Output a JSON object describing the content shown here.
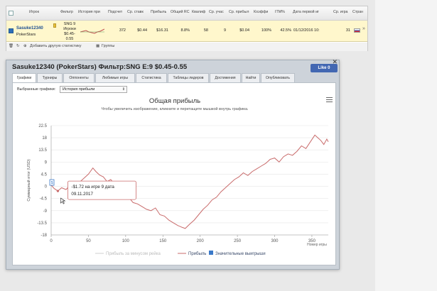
{
  "grid": {
    "headers": [
      "Игрок",
      "Фильтр",
      "История при",
      "Подсчет",
      "Ср. ставк",
      "Прибыль",
      "Общий RC",
      "Квалиф",
      "Ср. учас",
      "Ср. прибыл",
      "Коэффи",
      "ITM%",
      "Дата первой иг",
      "Ср. игра",
      "Стран"
    ],
    "row": {
      "player": "Sasuke12340",
      "site": "PokerStars",
      "filter": [
        "SNG 9",
        "Игроки",
        "$0.45-",
        "0.55"
      ],
      "count": "372",
      "avg_stake": "$0.44",
      "profit": "$16.31",
      "roi": "8.8%",
      "qualif": "58",
      "avg_part": "9",
      "avg_profit": "$0.04",
      "coef": "100%",
      "itm": "42.5%",
      "first_date": "01/12/2016 10:",
      "avg_game": "31"
    },
    "footer": {
      "add_label": "Добавить другую статистику",
      "groups_label": "Группы"
    }
  },
  "popup": {
    "title": "Sasuke12340 (PokerStars) Фильтр:SNG E:9 $0.45-0.55",
    "like_label": "Like 0",
    "tabs": [
      "Графики",
      "Турниры",
      "Оппоненты",
      "Любимые игры",
      "Статистика",
      "Таблицы лидеров",
      "Достижения",
      "Найти",
      "Опубликовать"
    ],
    "select_label": "Выбранные графики:",
    "select_value": "История прибыли"
  },
  "colors": {
    "profit_line": "#c96b6b",
    "big_win": "#3a79c9",
    "grid_line": "#e6e6e6"
  },
  "chart_data": {
    "type": "line",
    "title": "Общая прибыль",
    "subtitle": "Чтобы увеличить изображение, кликните и перетащите мышкой внутрь графика.",
    "ylabel": "Суммарный итог (USD)",
    "xlabel": "Номер игры",
    "xlim": [
      0,
      372
    ],
    "ylim": [
      -18,
      22.5
    ],
    "x_ticks": [
      0,
      50,
      100,
      150,
      200,
      250,
      300,
      350
    ],
    "y_ticks": [
      22.5,
      18,
      13.5,
      9,
      4.5,
      0,
      -4.5,
      -9,
      -13.5,
      -18
    ],
    "legend": [
      "Прибыль за минусом рейка",
      "Прибыль",
      "Значительные выигрыши"
    ],
    "series": [
      {
        "name": "Прибыль",
        "x": [
          0,
          4,
          9,
          14,
          20,
          26,
          32,
          38,
          44,
          50,
          56,
          60,
          65,
          70,
          75,
          80,
          86,
          92,
          98,
          104,
          110,
          116,
          122,
          128,
          134,
          140,
          146,
          152,
          158,
          164,
          170,
          176,
          180,
          186,
          192,
          198,
          204,
          210,
          216,
          222,
          228,
          234,
          240,
          246,
          252,
          258,
          264,
          270,
          276,
          282,
          288,
          294,
          300,
          306,
          312,
          318,
          324,
          330,
          336,
          342,
          348,
          354,
          358,
          362,
          366,
          370,
          372
        ],
        "y": [
          0.5,
          -0.8,
          -1.72,
          -0.5,
          -1.2,
          0.8,
          -0.6,
          1.5,
          3.0,
          4.5,
          6.8,
          5.5,
          4.2,
          3.5,
          1.8,
          2.5,
          0.5,
          -1.0,
          -2.5,
          -4.0,
          -6.0,
          -6.5,
          -7.5,
          -8.5,
          -9.0,
          -8.0,
          -10.5,
          -11.0,
          -12.5,
          -13.5,
          -14.5,
          -15.2,
          -15.6,
          -14.0,
          -12.5,
          -10.5,
          -8.5,
          -7.0,
          -5.0,
          -4.0,
          -2.0,
          -0.5,
          1.0,
          2.5,
          3.5,
          5.0,
          4.0,
          5.5,
          6.5,
          7.5,
          8.5,
          10.0,
          10.5,
          9.0,
          11.0,
          12.0,
          11.5,
          13.0,
          15.0,
          14.0,
          16.5,
          19.0,
          18.0,
          17.0,
          15.5,
          17.5,
          16.5
        ]
      }
    ],
    "tooltip": {
      "flag": "$",
      "text_line1": "-$1.72 на игре 9 дата",
      "text_line2": "09.11.2017",
      "x": 9,
      "y": -1.72
    }
  }
}
